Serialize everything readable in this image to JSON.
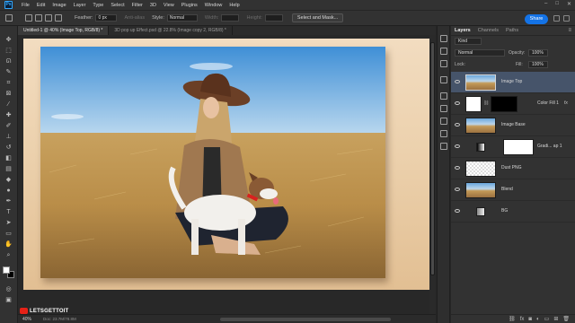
{
  "app": {
    "logo_text": "Ps"
  },
  "menu": [
    "File",
    "Edit",
    "Image",
    "Layer",
    "Type",
    "Select",
    "Filter",
    "3D",
    "View",
    "Plugins",
    "Window",
    "Help"
  ],
  "window_controls": [
    "–",
    "□",
    "✕"
  ],
  "options": {
    "feather_label": "Feather:",
    "feather_value": "0 px",
    "antialias_label": "Anti-alias",
    "style_label": "Style:",
    "style_value": "Normal",
    "width_label": "Width:",
    "height_label": "Height:",
    "select_mask_label": "Select and Mask...",
    "share_label": "Share"
  },
  "tabs": [
    {
      "label": "Untitled-1 @ 40% (Image Top, RGB/8) *",
      "active": true
    },
    {
      "label": "3D pop up Effect.psd @ 22.8% (Image copy 2, RGB/8) *",
      "active": false
    }
  ],
  "status": {
    "zoom": "40%",
    "doc_info": "Doc: 23.7M/78.8M"
  },
  "watermark": {
    "text": "LETSGETTOIT"
  },
  "layers_panel": {
    "tabs": [
      "Layers",
      "Channels",
      "Paths"
    ],
    "filter_kind": "Kind",
    "blend_mode": "Normal",
    "opacity_label": "Opacity:",
    "opacity_value": "100%",
    "lock_label": "Lock:",
    "fill_label": "Fill:",
    "fill_value": "100%",
    "layers": [
      {
        "name": "Image Top",
        "selected": true,
        "thumb": "photo"
      },
      {
        "name": "Color Fill 1",
        "selected": false,
        "thumb": "mask",
        "fx": "fx"
      },
      {
        "name": "Image Base",
        "selected": false,
        "thumb": "photo"
      },
      {
        "name": "Gradi... ap 1",
        "selected": false,
        "thumb": "white"
      },
      {
        "name": "Dust PNG",
        "selected": false,
        "thumb": "checker"
      },
      {
        "name": "Blend",
        "selected": false,
        "thumb": "photo"
      },
      {
        "name": "BG",
        "selected": false,
        "thumb": "gray"
      }
    ]
  },
  "colors": {
    "accent": "#1473e6",
    "selected_layer": "#46546a",
    "panel_bg": "#323232",
    "canvas_bg": "#282828"
  },
  "icons": [
    "move-icon",
    "marquee-icon",
    "lasso-icon",
    "quick-select-icon",
    "crop-icon",
    "frame-icon",
    "eyedropper-icon",
    "healing-icon",
    "brush-icon",
    "stamp-icon",
    "history-brush-icon",
    "eraser-icon",
    "gradient-icon",
    "blur-icon",
    "dodge-icon",
    "pen-icon",
    "type-icon",
    "path-select-icon",
    "rectangle-icon",
    "hand-icon",
    "zoom-icon"
  ]
}
